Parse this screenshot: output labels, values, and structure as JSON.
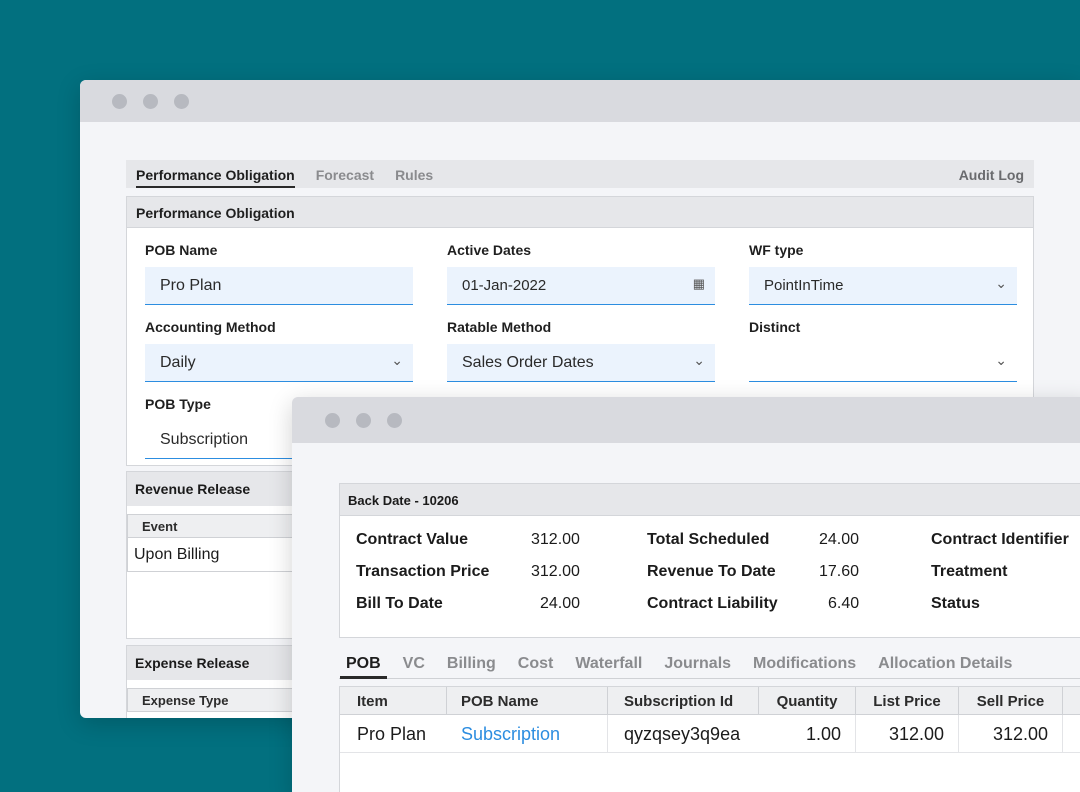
{
  "back_window": {
    "tabs": [
      {
        "label": "Performance Obligation",
        "active": true
      },
      {
        "label": "Forecast",
        "active": false
      },
      {
        "label": "Rules",
        "active": false
      }
    ],
    "audit_log_label": "Audit Log",
    "panel_title": "Performance Obligation",
    "fields": {
      "pob_name": {
        "label": "POB Name",
        "value": "Pro Plan"
      },
      "active_dates": {
        "label": "Active Dates",
        "value": "01-Jan-2022"
      },
      "wf_type": {
        "label": "WF type",
        "value": "PointInTime"
      },
      "accounting_method": {
        "label": "Accounting Method",
        "value": "Daily"
      },
      "ratable_method": {
        "label": "Ratable Method",
        "value": "Sales Order Dates"
      },
      "distinct": {
        "label": "Distinct",
        "value": ""
      },
      "pob_type": {
        "label": "POB Type",
        "value": "Subscription"
      }
    },
    "revenue_release": {
      "title": "Revenue Release",
      "column": "Event",
      "value": "Upon Billing"
    },
    "expense_release": {
      "title": "Expense Release",
      "column": "Expense Type"
    }
  },
  "front_window": {
    "summary_title": "Back Date - 10206",
    "summary": [
      {
        "label": "Contract Value",
        "value": "312.00"
      },
      {
        "label": "Transaction Price",
        "value": "312.00"
      },
      {
        "label": "Bill To Date",
        "value": "24.00"
      },
      {
        "label": "Total Scheduled",
        "value": "24.00"
      },
      {
        "label": "Revenue To Date",
        "value": "17.60"
      },
      {
        "label": "Contract Liability",
        "value": "6.40"
      },
      {
        "label": "Contract Identifier",
        "value": ""
      },
      {
        "label": "Treatment",
        "value": ""
      },
      {
        "label": "Status",
        "value": ""
      }
    ],
    "tabs": [
      {
        "label": "POB",
        "active": true
      },
      {
        "label": "VC",
        "active": false
      },
      {
        "label": "Billing",
        "active": false
      },
      {
        "label": "Cost",
        "active": false
      },
      {
        "label": "Waterfall",
        "active": false
      },
      {
        "label": "Journals",
        "active": false
      },
      {
        "label": "Modifications",
        "active": false
      },
      {
        "label": "Allocation Details",
        "active": false
      }
    ],
    "grid": {
      "columns": [
        "Item",
        "POB Name",
        "Subscription Id",
        "Quantity",
        "List Price",
        "Sell Price"
      ],
      "rows": [
        [
          "Pro Plan",
          "Subscription",
          "qyzqsey3q9ea",
          "1.00",
          "312.00",
          "312.00"
        ]
      ]
    }
  },
  "colors": {
    "background": "#02707f",
    "link": "#2c8de0",
    "field_fill": "#ebf3fd"
  }
}
